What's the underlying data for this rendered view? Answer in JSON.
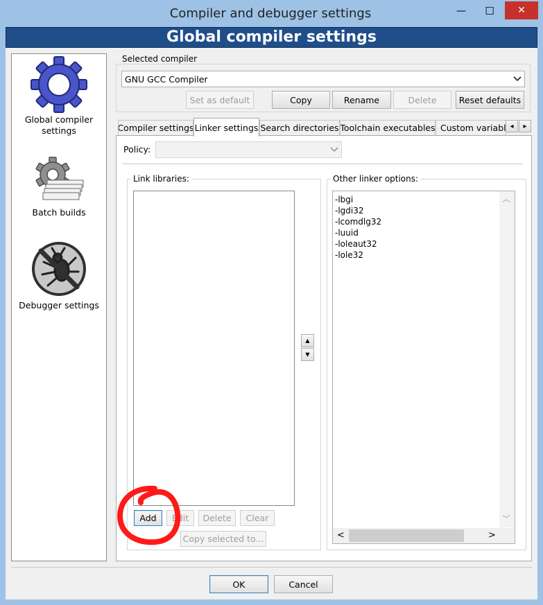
{
  "window": {
    "title": "Compiler and debugger settings",
    "banner": "Global compiler settings",
    "minimize_glyph": "—",
    "maximize_glyph": "☐",
    "close_glyph": "✕",
    "close_color": "#c7312b"
  },
  "sidebar": {
    "items": [
      {
        "label_line1": "Global compiler",
        "label_line2": "settings",
        "icon": "gear-icon"
      },
      {
        "label": "Batch builds",
        "icon": "gear-stack-icon"
      },
      {
        "label": "Debugger settings",
        "icon": "no-bug-icon"
      }
    ]
  },
  "compiler": {
    "group_label": "Selected compiler",
    "selected": "GNU GCC Compiler",
    "buttons": {
      "set_default": "Set as default",
      "copy": "Copy",
      "rename": "Rename",
      "delete": "Delete",
      "reset": "Reset defaults"
    }
  },
  "tabs": [
    {
      "label": "Compiler settings"
    },
    {
      "label": "Linker settings"
    },
    {
      "label": "Search directories"
    },
    {
      "label": "Toolchain executables"
    },
    {
      "label": "Custom variable"
    }
  ],
  "tab_scroll": {
    "left": "◂",
    "right": "▸"
  },
  "policy": {
    "label": "Policy:",
    "value": ""
  },
  "link_libraries": {
    "label": "Link libraries:",
    "items": [],
    "move_up": "▲",
    "move_down": "▼",
    "buttons": {
      "add": "Add",
      "edit": "Edit",
      "delete": "Delete",
      "clear": "Clear",
      "copy_selected": "Copy selected to..."
    }
  },
  "other_options": {
    "label": "Other linker options:",
    "lines": [
      "-lbgi",
      "-lgdi32",
      "-lcomdlg32",
      "-luuid",
      "-loleaut32",
      "-lole32"
    ],
    "scroll_left": "<",
    "scroll_right": ">",
    "scroll_up": "︿",
    "scroll_down": "﹀"
  },
  "footer": {
    "ok": "OK",
    "cancel": "Cancel"
  },
  "annotation_color": "#ff1a1a"
}
